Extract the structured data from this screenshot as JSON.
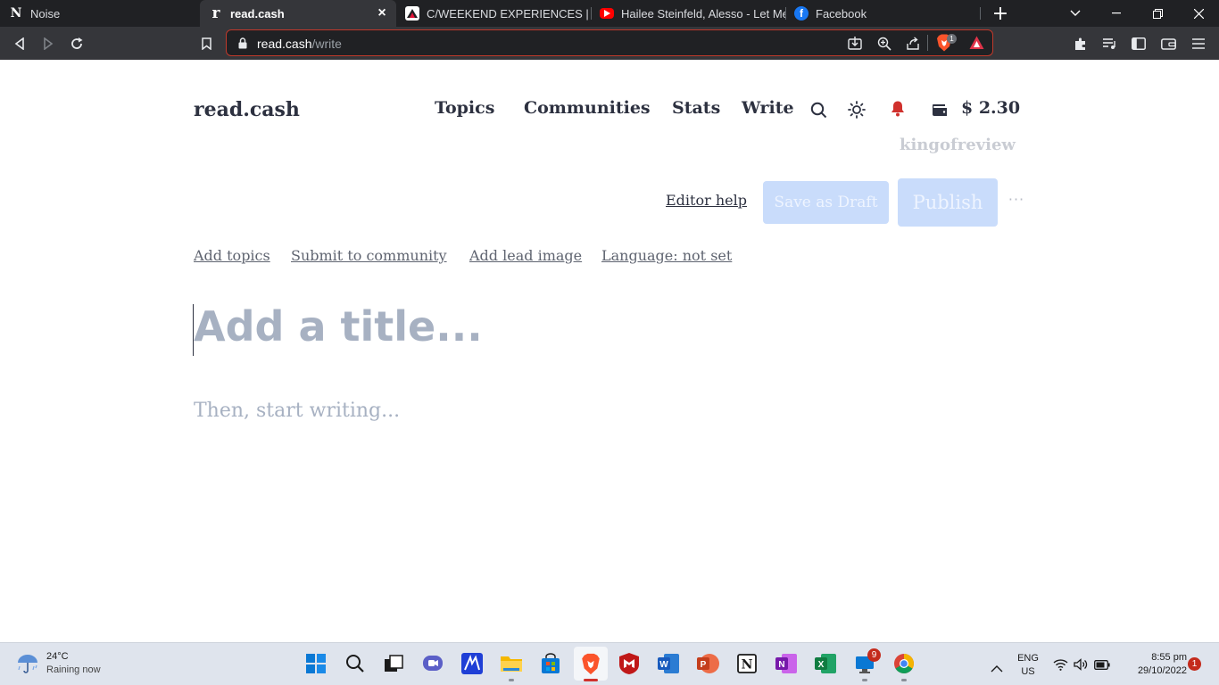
{
  "browser": {
    "tabs": [
      {
        "title": "Noise",
        "favicon": "noise-icon"
      },
      {
        "title": "read.cash",
        "favicon": "readcash-icon",
        "active": true
      },
      {
        "title": "C/WEEKEND EXPERIENCES | PeakD",
        "favicon": "peakd-icon"
      },
      {
        "title": "Hailee Steinfeld, Alesso - Let Me G",
        "favicon": "youtube-icon"
      },
      {
        "title": "Facebook",
        "favicon": "facebook-icon"
      }
    ],
    "url_host": "read.cash",
    "url_path": "/write",
    "brave_shield_count": "1"
  },
  "site": {
    "logo": "read.cash",
    "nav": {
      "topics": "Topics",
      "communities": "Communities",
      "stats": "Stats",
      "write": "Write"
    },
    "balance": "$ 2.30",
    "username": "kingofreview"
  },
  "editor": {
    "help_label": "Editor help",
    "save_draft_label": "Save as Draft",
    "publish_label": "Publish",
    "more_label": "···",
    "meta_links": {
      "add_topics": "Add topics",
      "submit_community": "Submit to community",
      "add_lead_image": "Add lead image",
      "language": "Language: not set"
    },
    "title_placeholder": "Add a title...",
    "body_placeholder": "Then, start writing..."
  },
  "taskbar": {
    "weather_temp": "24°C",
    "weather_desc": "Raining now",
    "lang_primary": "ENG",
    "lang_secondary": "US",
    "time": "8:55 pm",
    "date": "29/10/2022",
    "notification_count": "1",
    "app_badge_count": "9"
  },
  "colors": {
    "accent_button": "#c9dcfb",
    "text_dark": "#2d3140",
    "placeholder": "#a7b1c2",
    "notification_bell": "#d0312d"
  }
}
